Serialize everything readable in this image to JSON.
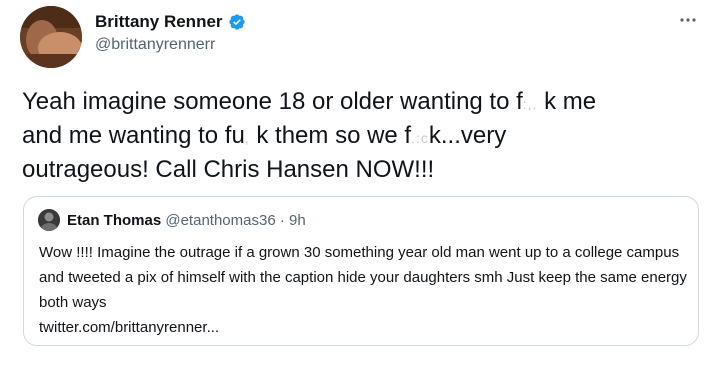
{
  "author": {
    "display_name": "Brittany Renner",
    "handle": "@brittanyrennerr",
    "verified": true,
    "avatar": "profile-photo"
  },
  "more_icon": "more-horizontal-icon",
  "tweet": {
    "line1_a": "Yeah imagine someone 18 or older wanting to f",
    "line1_b": "k me",
    "line2_a": "and me wanting to fu",
    "line2_b": "k them so we f",
    "line2_c": "k...very",
    "line3": "outrageous! Call Chris Hansen NOW!!!"
  },
  "quote": {
    "display_name": "Etan Thomas",
    "handle": "@etanthomas36",
    "separator": "·",
    "time": "9h",
    "text": "Wow !!!! Imagine the outrage if a grown 30 something year old man went up to a college campus and tweeted a pix of himself with the caption hide your daughters smh Just keep the same energy both ways",
    "link": "twitter.com/brittanyrenner..."
  },
  "colors": {
    "text": "#0f1419",
    "secondary": "#536471",
    "border": "#cfd9de",
    "verified": "#1d9bf0"
  }
}
